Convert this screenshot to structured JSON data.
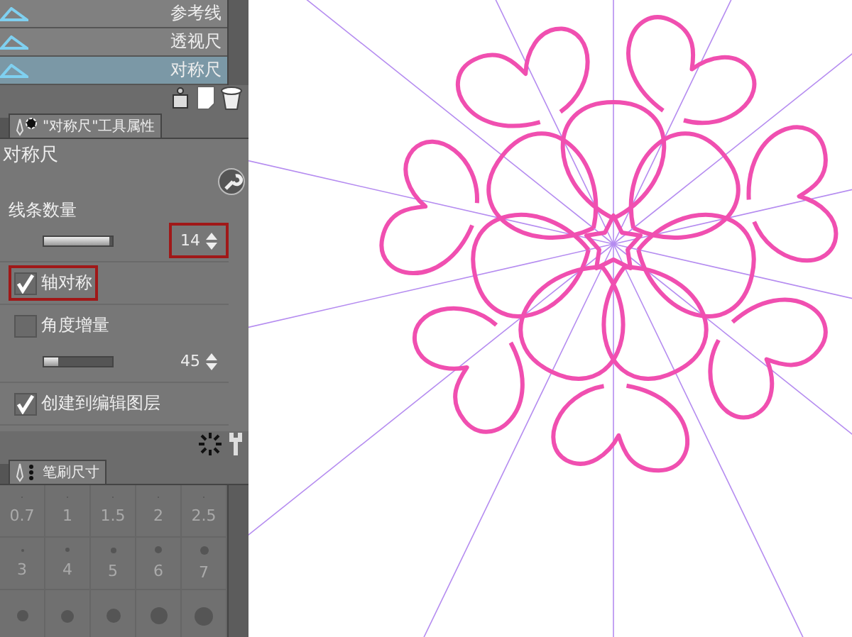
{
  "ruler_list": {
    "items": [
      {
        "label": "参考线",
        "selected": false
      },
      {
        "label": "透视尺",
        "selected": false
      },
      {
        "label": "对称尺",
        "selected": true
      }
    ]
  },
  "property_tab": {
    "label": "\"对称尺\"工具属性",
    "selected": true
  },
  "tool_name": "对称尺",
  "settings": [
    {
      "kind": "number",
      "label": "线条数量",
      "value": "14",
      "level": 0.95,
      "highlighted": true
    },
    {
      "kind": "checkbox",
      "label": "轴对称",
      "checked": true,
      "highlighted": true
    },
    {
      "kind": "number_toggle",
      "label": "角度增量",
      "checked": false,
      "value": "45",
      "level": 0.2,
      "highlighted": false
    },
    {
      "kind": "checkbox",
      "label": "创建到编辑图层",
      "checked": true,
      "highlighted": false
    }
  ],
  "brush_tab": {
    "label": "笔刷尺寸",
    "selected": true
  },
  "brush_sizes": [
    {
      "label": "0.7"
    },
    {
      "label": "1"
    },
    {
      "label": "1.5"
    },
    {
      "label": "2"
    },
    {
      "label": "2.5"
    },
    {
      "label": "3"
    },
    {
      "label": "4"
    },
    {
      "label": "5"
    },
    {
      "label": "6"
    },
    {
      "label": "7"
    }
  ]
}
